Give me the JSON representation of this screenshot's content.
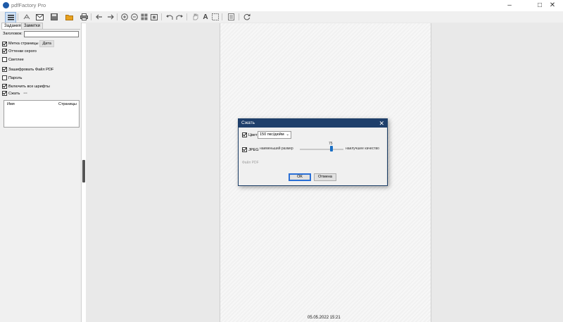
{
  "window": {
    "title": "pdfFactory Pro"
  },
  "left_panel": {
    "tabs": [
      "Задания",
      "Заметки"
    ],
    "title_label": "Заголовок:",
    "title_value": "",
    "page_label": {
      "label": "Метка страницы",
      "suffix": "Дата",
      "checked": true
    },
    "grayscale": {
      "label": "Оттенки серого",
      "checked": true
    },
    "lighter": {
      "label": "Светлее",
      "checked": false
    },
    "encrypt": {
      "label": "Зашифровать Файл PDF",
      "checked": true
    },
    "password": {
      "label": "Пароль",
      "checked": false
    },
    "embed_fonts": {
      "label": "Включить все шрифты",
      "checked": true
    },
    "compress": {
      "label": "Сжать",
      "checked": true,
      "more": "···"
    },
    "list_columns": [
      "Имя",
      "Страницы"
    ]
  },
  "page_footer": "05.05.2022 15:21",
  "dialog": {
    "title": "Сжать",
    "close_glyph": "✕",
    "color": {
      "label": "Цвет",
      "checked": true,
      "value": "150 пкс/дюйм"
    },
    "jpeg": {
      "label": "JPEG",
      "checked": true,
      "min_label": "наименьший размер",
      "max_label": "наилучшее качество",
      "value": "75"
    },
    "pdf_file_label": "Файл PDF",
    "ok_label": "OK",
    "cancel_label": "Отмена"
  }
}
